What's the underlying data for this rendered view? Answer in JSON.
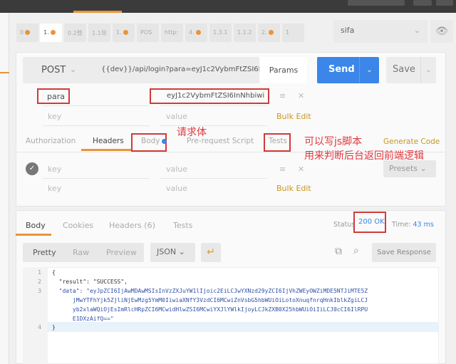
{
  "tabs": [
    {
      "label": "0",
      "dot": true
    },
    {
      "label": "1.",
      "dot": true,
      "active": true
    },
    {
      "label": "0.2登",
      "dot": false
    },
    {
      "label": "1.1导",
      "dot": false
    },
    {
      "label": "1.",
      "dot": true
    },
    {
      "label": "POS",
      "dot": false
    },
    {
      "label": "http:",
      "dot": false
    },
    {
      "label": "4.",
      "dot": true
    },
    {
      "label": "1.3.1",
      "dot": false
    },
    {
      "label": "1.1.2",
      "dot": false
    },
    {
      "label": "2.",
      "dot": true
    },
    {
      "label": "1",
      "dot": false
    }
  ],
  "environment": {
    "selected": "sifa"
  },
  "request": {
    "method": "POST",
    "url": "{{dev}}/api/login?para=eyJ1c2VybmFtZSI6InNhbiwi",
    "params_label": "Params",
    "send_label": "Send",
    "save_label": "Save",
    "params": [
      {
        "key": "para",
        "value": "eyJ1c2VybmFtZSI6InNhbiwi"
      }
    ],
    "key_placeholder": "key",
    "value_placeholder": "value",
    "bulk_edit": "Bulk Edit",
    "tabs": [
      "Authorization",
      "Headers",
      "Body",
      "Pre-request Script",
      "Tests"
    ],
    "active_tab": "Headers",
    "generate_code": "Generate Code",
    "presets": "Presets"
  },
  "annotations": {
    "body": "请求体",
    "tests_line1": "可以写js脚本",
    "tests_line2": "用来判断后台返回前端逻辑"
  },
  "response": {
    "tabs": [
      "Body",
      "Cookies",
      "Headers (6)",
      "Tests"
    ],
    "active_tab": "Body",
    "status_label": "Status",
    "status": "200 OK",
    "time_label": "Time:",
    "time": "43 ms",
    "view_modes": [
      "Pretty",
      "Raw",
      "Preview"
    ],
    "format": "JSON",
    "save_response": "Save Response",
    "lines": [
      "{",
      "  \"result\": \"SUCCESS\",",
      "  \"data\": \"eyJpZCI6IjAwMDAwMSIsInVzZXJuYW1lIjoic2EiLCJwYXNzd29yZCI6IjVhZWEyOWZiMDE5NTJiMTE5Z",
      "      jMwYTFhYjk5ZjliNjEwMzg5YmM0IiwiaXNfY3VzdCI6MCwiZnVsbG5hbWUiOiLotoXnuqfnrqHnkIblkZgiLCJ",
      "      yb2xlaWQiOjEsImRlcHRpZCI6MCwidHlwZSI6MCwiYXJlYWlkIjoyLCJkZXB0X25hbWUiOiIiLCJ0cCI6IlRPU",
      "      E1DXzAifQ==\"",
      "}"
    ],
    "line_numbers": [
      "1",
      "2",
      "3",
      "",
      "",
      "",
      "4"
    ]
  },
  "colors": {
    "accent": "#e8953a",
    "send": "#3b86e8",
    "annotation": "#e0383e",
    "bulk_edit": "#c8961d"
  }
}
